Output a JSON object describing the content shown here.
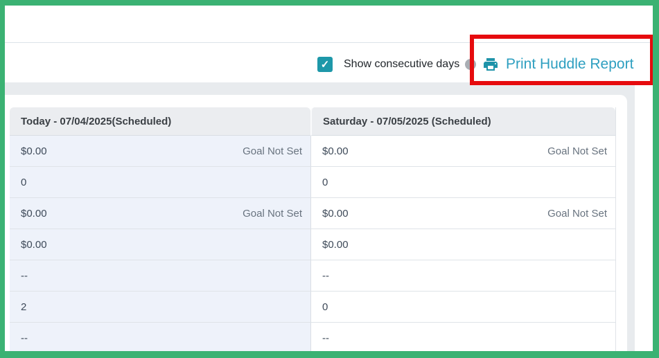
{
  "frame": {
    "border_color": "#3BB273",
    "highlight_color": "#E60B0E"
  },
  "toolbar": {
    "checkbox": {
      "label": "Show consecutive days",
      "checked": true,
      "check_glyph": "✓",
      "accent_color": "#1E98A9"
    },
    "print_button": {
      "label": "Print Huddle Report",
      "icon": "printer-icon",
      "text_color": "#2E9FC0",
      "icon_color": "#1E93A9"
    }
  },
  "table": {
    "columns": [
      {
        "header": "Today - 07/04/2025(Scheduled)",
        "highlight_bg": "#EEF2FA"
      },
      {
        "header": "Saturday - 07/05/2025 (Scheduled)",
        "highlight_bg": "#FFFFFF"
      }
    ],
    "rows": [
      {
        "cells": [
          {
            "value": "$0.00",
            "note": "Goal Not Set"
          },
          {
            "value": "$0.00",
            "note": "Goal Not Set"
          }
        ]
      },
      {
        "cells": [
          {
            "value": "0",
            "note": ""
          },
          {
            "value": "0",
            "note": ""
          }
        ]
      },
      {
        "cells": [
          {
            "value": "$0.00",
            "note": "Goal Not Set"
          },
          {
            "value": "$0.00",
            "note": "Goal Not Set"
          }
        ]
      },
      {
        "cells": [
          {
            "value": "$0.00",
            "note": ""
          },
          {
            "value": "$0.00",
            "note": ""
          }
        ]
      },
      {
        "cells": [
          {
            "value": "--",
            "note": ""
          },
          {
            "value": "--",
            "note": ""
          }
        ]
      },
      {
        "cells": [
          {
            "value": "2",
            "note": ""
          },
          {
            "value": "0",
            "note": ""
          }
        ]
      },
      {
        "cells": [
          {
            "value": "--",
            "note": ""
          },
          {
            "value": "--",
            "note": ""
          }
        ]
      }
    ]
  }
}
